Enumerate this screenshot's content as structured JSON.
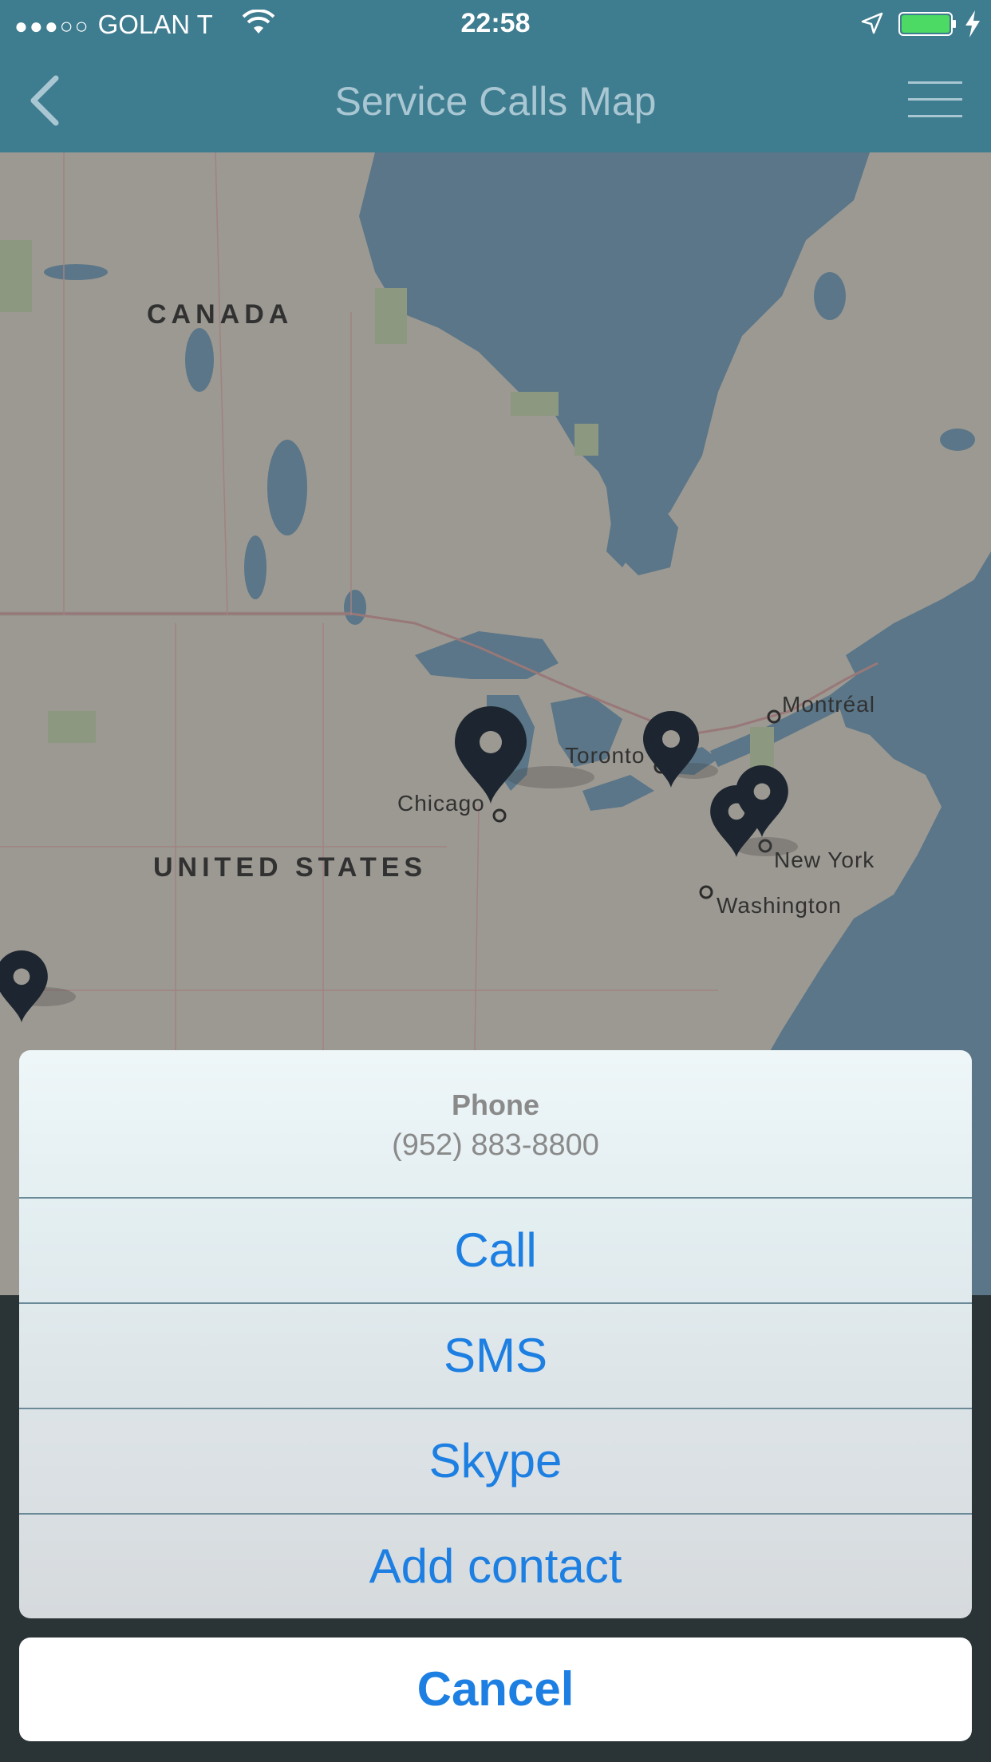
{
  "status_bar": {
    "signal_dots": "●●●○○",
    "carrier": "GOLAN T",
    "time": "22:58",
    "battery_color": "#4cd964"
  },
  "nav": {
    "title": "Service Calls Map",
    "back_icon": "chevron-left-icon",
    "menu_icon": "hamburger-menu-icon",
    "bar_color": "#3e7c8f"
  },
  "map": {
    "countries": [
      "CANADA",
      "UNITED STATES"
    ],
    "cities": [
      "Montréal",
      "Toronto",
      "Chicago",
      "New York",
      "Washington"
    ],
    "water_color": "#7299b2",
    "land_color": "#cdc9c0",
    "pin_color": "#1e2a38"
  },
  "action_sheet": {
    "title": "Phone",
    "subtitle": "(952) 883-8800",
    "options": [
      "Call",
      "SMS",
      "Skype",
      "Add contact"
    ],
    "cancel_label": "Cancel",
    "accent_color": "#1d7fe2"
  }
}
